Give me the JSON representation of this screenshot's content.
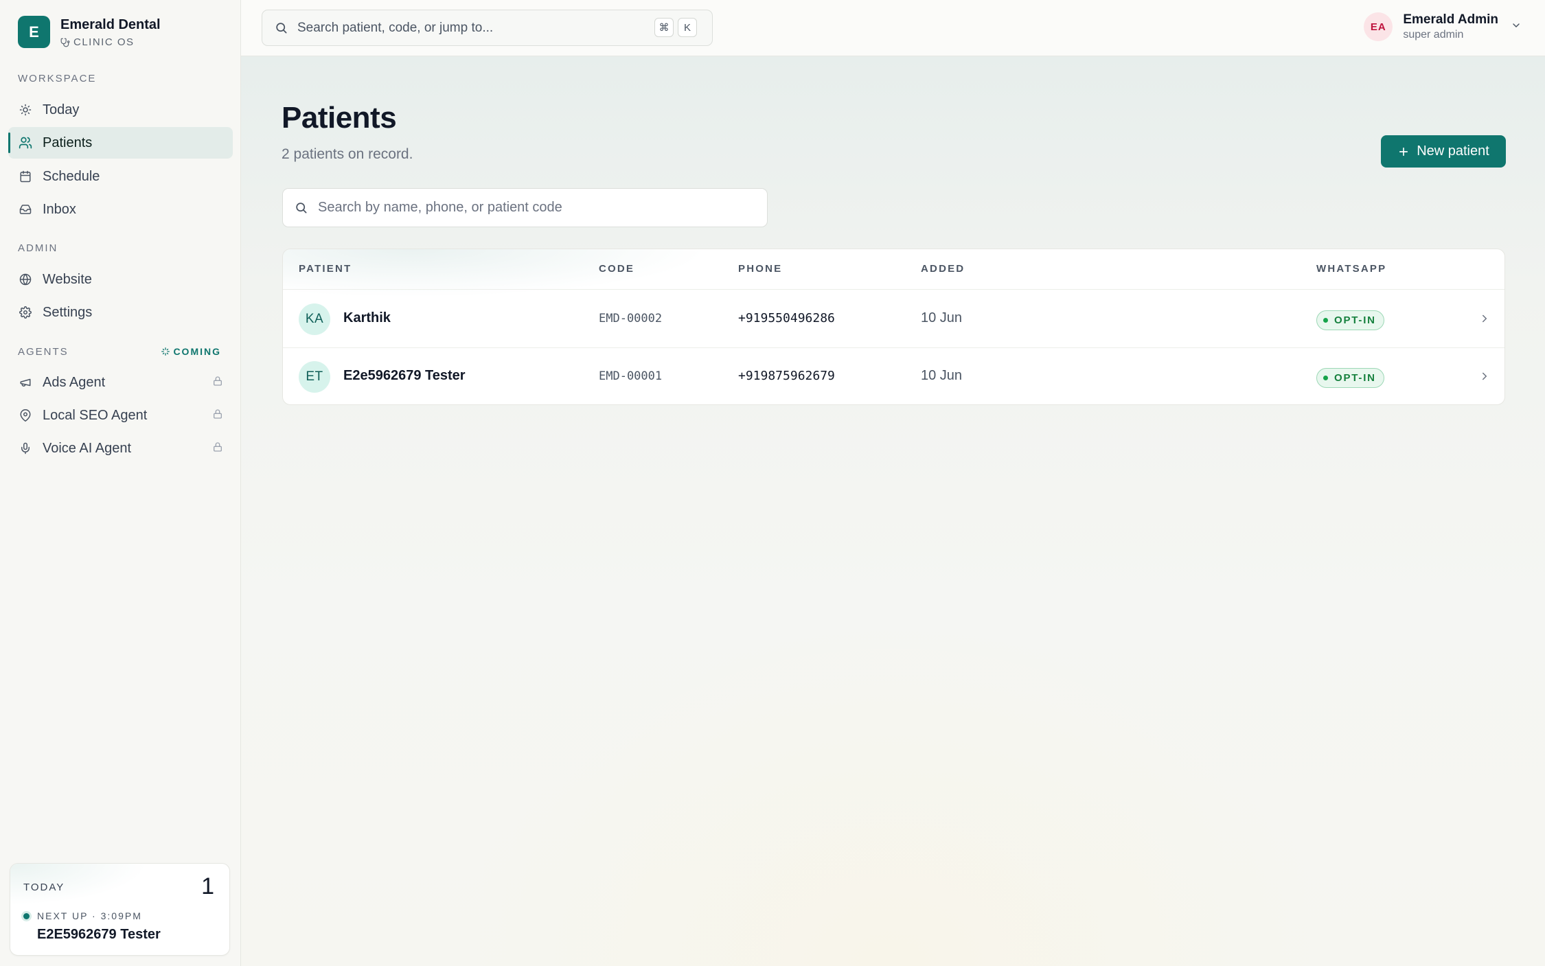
{
  "brand": {
    "logo_letter": "E",
    "name": "Emerald Dental",
    "subtitle": "CLINIC OS"
  },
  "sidebar": {
    "workspace_label": "WORKSPACE",
    "workspace_items": [
      {
        "label": "Today",
        "icon": "sun-icon"
      },
      {
        "label": "Patients",
        "icon": "users-icon",
        "active": true
      },
      {
        "label": "Schedule",
        "icon": "calendar-icon"
      },
      {
        "label": "Inbox",
        "icon": "inbox-icon"
      }
    ],
    "admin_label": "ADMIN",
    "admin_items": [
      {
        "label": "Website",
        "icon": "globe-icon"
      },
      {
        "label": "Settings",
        "icon": "gear-icon"
      }
    ],
    "agents_label": "AGENTS",
    "coming_label": "COMING",
    "agent_items": [
      {
        "label": "Ads Agent",
        "icon": "megaphone-icon",
        "locked": true
      },
      {
        "label": "Local SEO Agent",
        "icon": "map-pin-icon",
        "locked": true
      },
      {
        "label": "Voice AI Agent",
        "icon": "microphone-icon",
        "locked": true
      }
    ],
    "today_card": {
      "label": "TODAY",
      "count": "1",
      "next_up": "NEXT UP · 3:09PM",
      "next_name": "E2E5962679 Tester"
    }
  },
  "topbar": {
    "search_placeholder": "Search patient, code, or jump to...",
    "shortcut_keys": [
      "⌘",
      "K"
    ],
    "user": {
      "initials": "EA",
      "name": "Emerald Admin",
      "role": "super admin"
    }
  },
  "main": {
    "title": "Patients",
    "subtitle": "2 patients on record.",
    "new_button_label": "New patient",
    "search_placeholder": "Search by name, phone, or patient code",
    "table": {
      "columns": [
        "PATIENT",
        "CODE",
        "PHONE",
        "ADDED",
        "WHATSAPP"
      ],
      "rows": [
        {
          "initials": "KA",
          "name": "Karthik",
          "code": "EMD-00002",
          "phone": "+919550496286",
          "added": "10 Jun",
          "whatsapp": "OPT-IN"
        },
        {
          "initials": "ET",
          "name": "E2e5962679 Tester",
          "code": "EMD-00001",
          "phone": "+919875962679",
          "added": "10 Jun",
          "whatsapp": "OPT-IN"
        }
      ]
    }
  },
  "colors": {
    "accent": "#0f766e",
    "accent_soft": "#e3ece9",
    "success": "#15803d",
    "avatar_user_bg": "#fbe4e7"
  }
}
